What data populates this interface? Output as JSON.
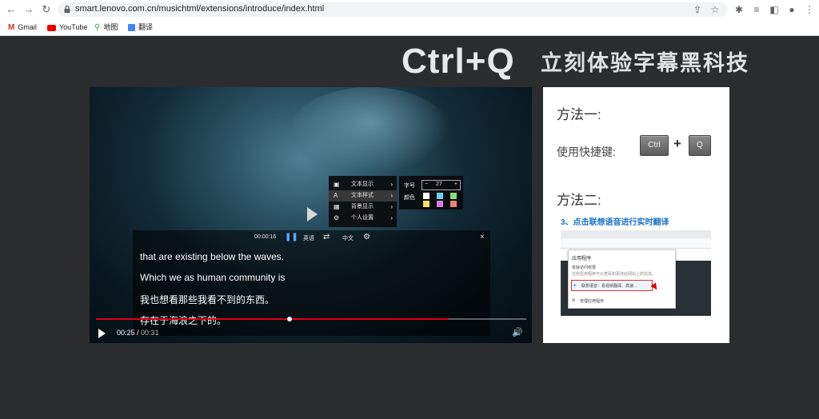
{
  "browser": {
    "url": "smart.lenovo.com.cn/musichtml/extensions/introduce/index.html",
    "bookmarks": [
      {
        "label": "Gmail",
        "icon": "gmail-icon"
      },
      {
        "label": "YouTube",
        "icon": "youtube-icon"
      },
      {
        "label": "地图",
        "icon": "maps-icon"
      },
      {
        "label": "翻译",
        "icon": "translate-icon"
      }
    ]
  },
  "banner": {
    "shortcut": "Ctrl+Q",
    "tagline": "立刻体验字幕黑科技"
  },
  "video": {
    "context_menu": [
      {
        "label": "文本显示",
        "icon": "text-display-icon"
      },
      {
        "label": "文本样式",
        "icon": "text-style-icon"
      },
      {
        "label": "背景显示",
        "icon": "background-icon"
      },
      {
        "label": "个人设置",
        "icon": "settings-icon"
      }
    ],
    "style_panel": {
      "size_label": "字号",
      "size_value": "27",
      "minus": "−",
      "plus": "+",
      "color_label": "颜色",
      "swatches": [
        "#ffffff",
        "#6fd0f0",
        "#86e07a",
        "#f5e15a",
        "#e07ae0",
        "#f08080"
      ]
    },
    "subtitle_bar": {
      "timestamp": "00:00:16",
      "source_lang": "英语",
      "target_lang": "中文",
      "close": "×"
    },
    "subtitles": [
      "that are existing below the waves.",
      "Which we as human community is",
      "我也想看那些我看不到的东西。",
      "存在于海浪之下的。"
    ],
    "progress": {
      "played_fraction": 0.82,
      "buffer_fraction": 0.45
    },
    "current_time": "00:25",
    "separator": " / ",
    "duration": "00:31"
  },
  "instructions": {
    "method1_title": "方法一:",
    "shortcut_label": "使用快捷键:",
    "key1": "Ctrl",
    "plus_sign": "+",
    "key2": "Q",
    "method2_title": "方法二:",
    "step3": "3、点击联想语音进行实时翻译",
    "popup": {
      "title": "应用程序",
      "line1": "有缺访问权限",
      "line2": "这些应用程序可以查看和更改此网站上的信息。",
      "item": "联想语音：看视频翻译、高速...",
      "manage": "管理应用程序"
    }
  }
}
